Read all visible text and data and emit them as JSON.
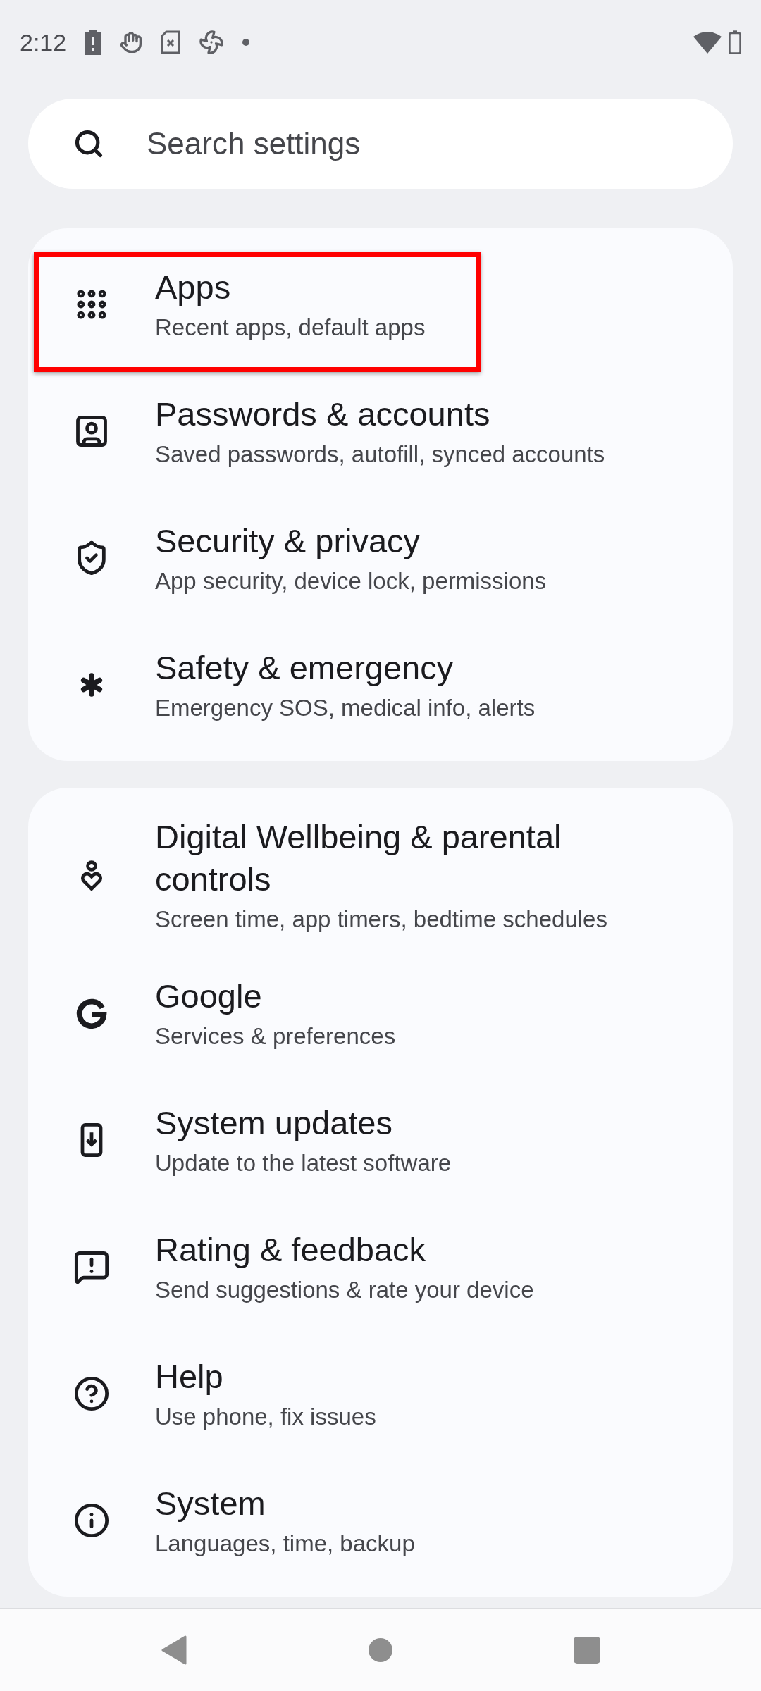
{
  "status_bar": {
    "time": "2:12"
  },
  "search": {
    "placeholder": "Search settings"
  },
  "groups": [
    {
      "items": [
        {
          "kind": "apps",
          "title": "Apps",
          "subtitle": "Recent apps, default apps",
          "highlighted": true
        },
        {
          "kind": "account",
          "title": "Passwords & accounts",
          "subtitle": "Saved passwords, autofill, synced accounts",
          "highlighted": false
        },
        {
          "kind": "shield",
          "title": "Security & privacy",
          "subtitle": "App security, device lock, permissions",
          "highlighted": false
        },
        {
          "kind": "asterisk",
          "title": "Safety & emergency",
          "subtitle": "Emergency SOS, medical info, alerts",
          "highlighted": false
        }
      ]
    },
    {
      "items": [
        {
          "kind": "wellbeing",
          "title": "Digital Wellbeing & parental controls",
          "subtitle": "Screen time, app timers, bedtime schedules",
          "highlighted": false
        },
        {
          "kind": "g",
          "title": "Google",
          "subtitle": "Services & preferences",
          "highlighted": false
        },
        {
          "kind": "update",
          "title": "System updates",
          "subtitle": "Update to the latest software",
          "highlighted": false
        },
        {
          "kind": "feedback",
          "title": "Rating & feedback",
          "subtitle": "Send suggestions & rate your device",
          "highlighted": false
        },
        {
          "kind": "help",
          "title": "Help",
          "subtitle": "Use phone, fix issues",
          "highlighted": false
        },
        {
          "kind": "info",
          "title": "System",
          "subtitle": "Languages, time, backup",
          "highlighted": false
        }
      ]
    }
  ]
}
